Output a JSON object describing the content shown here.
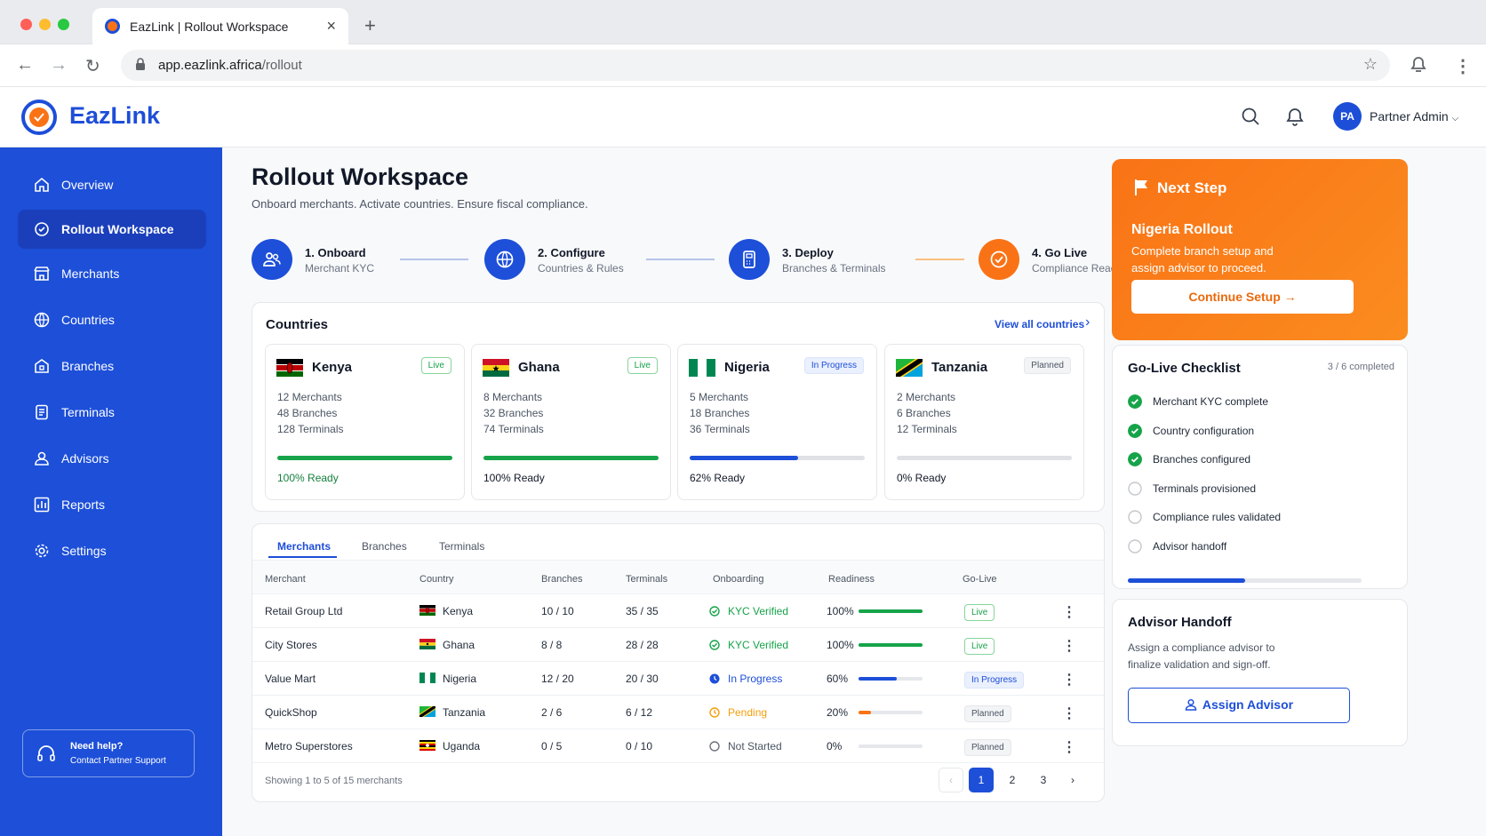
{
  "browser": {
    "tab_title": "EazLink | Rollout Workspace",
    "url_domain": "app.eazlink.africa",
    "url_path": "/rollout"
  },
  "header": {
    "logo": "EazLink",
    "user_initials": "PA",
    "user_name": "Partner Admin"
  },
  "sidebar": {
    "items": [
      {
        "label": "Overview",
        "icon": "home-icon"
      },
      {
        "label": "Rollout Workspace",
        "icon": "rollout-icon"
      },
      {
        "label": "Merchants",
        "icon": "store-icon"
      },
      {
        "label": "Countries",
        "icon": "globe-icon"
      },
      {
        "label": "Branches",
        "icon": "branch-icon"
      },
      {
        "label": "Terminals",
        "icon": "terminal-icon"
      },
      {
        "label": "Advisors",
        "icon": "user-icon"
      },
      {
        "label": "Reports",
        "icon": "chart-icon"
      },
      {
        "label": "Settings",
        "icon": "gear-icon"
      }
    ],
    "help_title": "Need help?",
    "help_sub": "Contact Partner Support"
  },
  "page": {
    "title": "Rollout Workspace",
    "subtitle": "Onboard merchants. Activate countries. Ensure fiscal compliance."
  },
  "steps": [
    {
      "title": "1. Onboard",
      "sub": "Merchant KYC"
    },
    {
      "title": "2. Configure",
      "sub": "Countries & Rules"
    },
    {
      "title": "3. Deploy",
      "sub": "Branches & Terminals"
    },
    {
      "title": "4. Go Live",
      "sub": "Compliance Ready"
    }
  ],
  "countries_card": {
    "title": "Countries",
    "view_all": "View all countries",
    "items": [
      {
        "name": "Kenya",
        "badge": "Live",
        "merchants": "12 Merchants",
        "branches": "48 Branches",
        "terminals": "128 Terminals",
        "ready": "100% Ready",
        "progress": 100
      },
      {
        "name": "Ghana",
        "badge": "Live",
        "merchants": "8 Merchants",
        "branches": "32 Branches",
        "terminals": "74 Terminals",
        "ready": "100% Ready",
        "progress": 100
      },
      {
        "name": "Nigeria",
        "badge": "In Progress",
        "merchants": "5 Merchants",
        "branches": "18 Branches",
        "terminals": "36 Terminals",
        "ready": "62% Ready",
        "progress": 62
      },
      {
        "name": "Tanzania",
        "badge": "Planned",
        "merchants": "2 Merchants",
        "branches": "6 Branches",
        "terminals": "12 Terminals",
        "ready": "0% Ready",
        "progress": 0
      }
    ]
  },
  "table": {
    "tabs": [
      "Merchants",
      "Branches",
      "Terminals"
    ],
    "headers": [
      "Merchant",
      "Country",
      "Branches",
      "Terminals",
      "Onboarding",
      "Readiness",
      "Go-Live"
    ],
    "rows": [
      {
        "merchant": "Retail Group Ltd",
        "country": "Kenya",
        "branches": "10 / 10",
        "terminals": "35 / 35",
        "onboarding": "KYC Verified",
        "readiness": "100%",
        "readiness_value": 100,
        "golive": "Live"
      },
      {
        "merchant": "City Stores",
        "country": "Ghana",
        "branches": "8 / 8",
        "terminals": "28 / 28",
        "onboarding": "KYC Verified",
        "readiness": "100%",
        "readiness_value": 100,
        "golive": "Live"
      },
      {
        "merchant": "Value Mart",
        "country": "Nigeria",
        "branches": "12 / 20",
        "terminals": "20 / 30",
        "onboarding": "In Progress",
        "readiness": "60%",
        "readiness_value": 60,
        "golive": "In Progress"
      },
      {
        "merchant": "QuickShop",
        "country": "Tanzania",
        "branches": "2 / 6",
        "terminals": "6 / 12",
        "onboarding": "Pending",
        "readiness": "20%",
        "readiness_value": 20,
        "golive": "Planned"
      },
      {
        "merchant": "Metro Superstores",
        "country": "Uganda",
        "branches": "0 / 5",
        "terminals": "0 / 10",
        "onboarding": "Not Started",
        "readiness": "0%",
        "readiness_value": 0,
        "golive": "Planned"
      }
    ],
    "footer": "Showing 1 to 5 of 15 merchants",
    "pages": [
      "1",
      "2",
      "3"
    ]
  },
  "next_step": {
    "heading": "Next Step",
    "name": "Nigeria Rollout",
    "desc": "Complete branch setup and assign advisor to proceed.",
    "button": "Continue Setup"
  },
  "checklist": {
    "title": "Go-Live Checklist",
    "count": "3 / 6 completed",
    "progress": 0.5,
    "items": [
      {
        "label": "Merchant KYC complete",
        "done": true
      },
      {
        "label": "Country configuration",
        "done": true
      },
      {
        "label": "Branches configured",
        "done": true
      },
      {
        "label": "Terminals provisioned",
        "done": false
      },
      {
        "label": "Compliance rules validated",
        "done": false
      },
      {
        "label": "Advisor handoff",
        "done": false
      }
    ]
  },
  "advisor": {
    "title": "Advisor Handoff",
    "desc": "Assign a compliance advisor to finalize validation and sign-off.",
    "button": "Assign Advisor"
  },
  "colors": {
    "primary": "#1d4fd8",
    "accent": "#f97316",
    "success": "#16a34a"
  }
}
